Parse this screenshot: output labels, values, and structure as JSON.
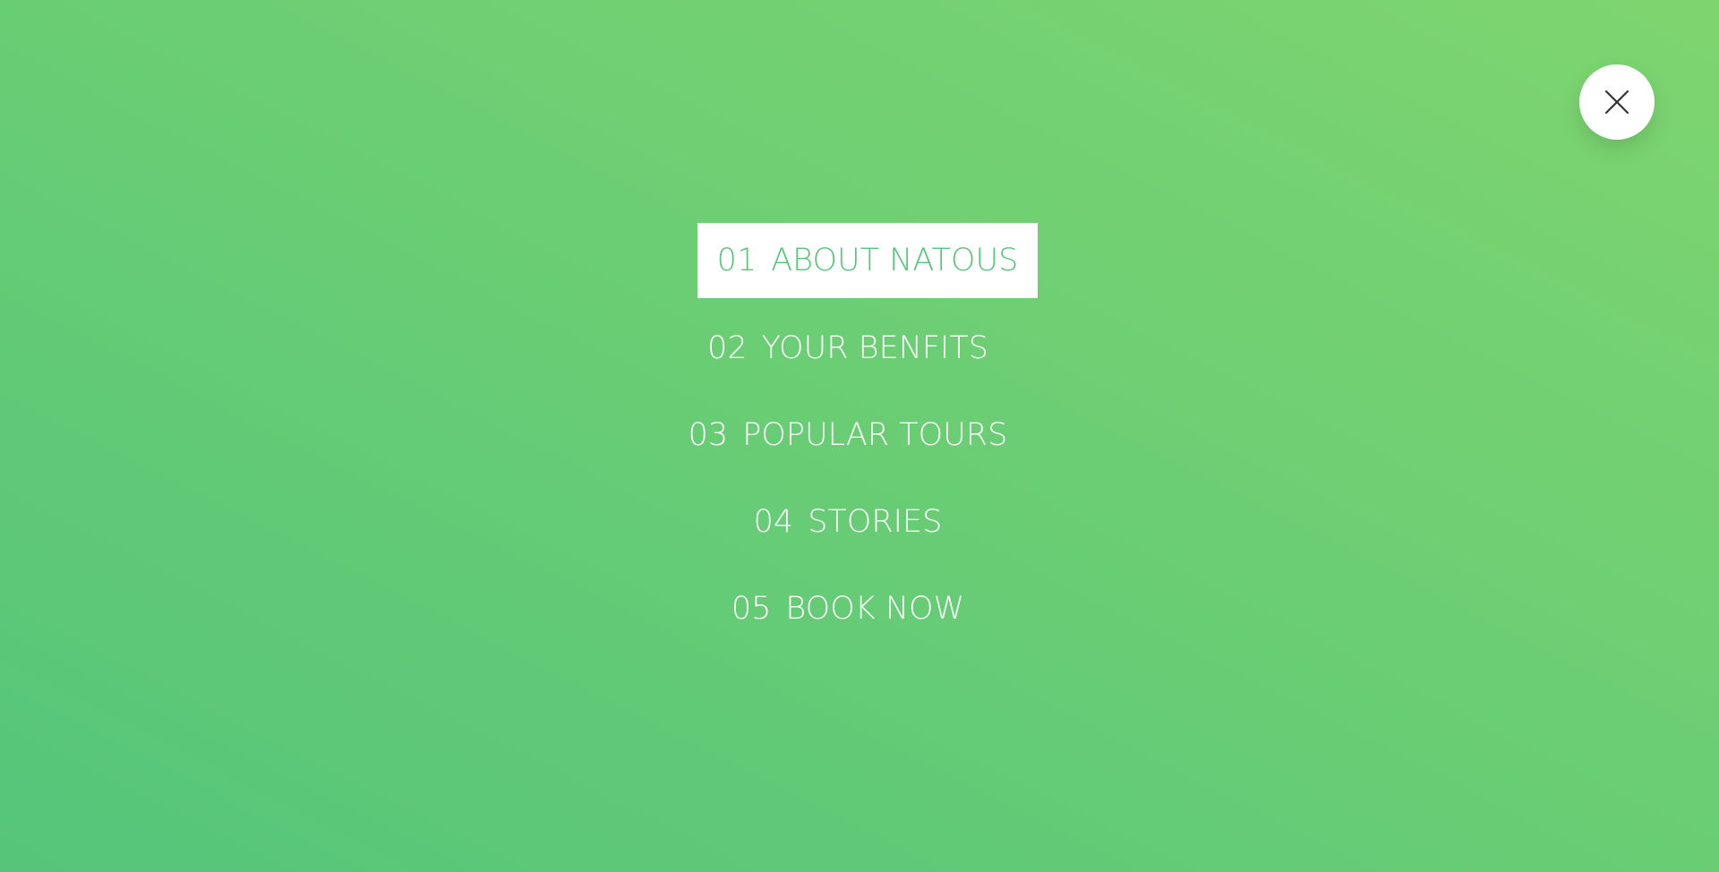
{
  "navigation": {
    "close_icon": "close-icon",
    "active_index": 0,
    "items": [
      {
        "number": "01",
        "label": "ABOUT NATOUS"
      },
      {
        "number": "02",
        "label": "YOUR BENFITS"
      },
      {
        "number": "03",
        "label": "POPULAR TOURS"
      },
      {
        "number": "04",
        "label": "STORIES"
      },
      {
        "number": "05",
        "label": "BOOK NOW"
      }
    ]
  },
  "colors": {
    "gradient_light": "#7ed56f",
    "gradient_dark": "#55c57a",
    "active_background": "#ffffff",
    "text": "#ffffff"
  }
}
